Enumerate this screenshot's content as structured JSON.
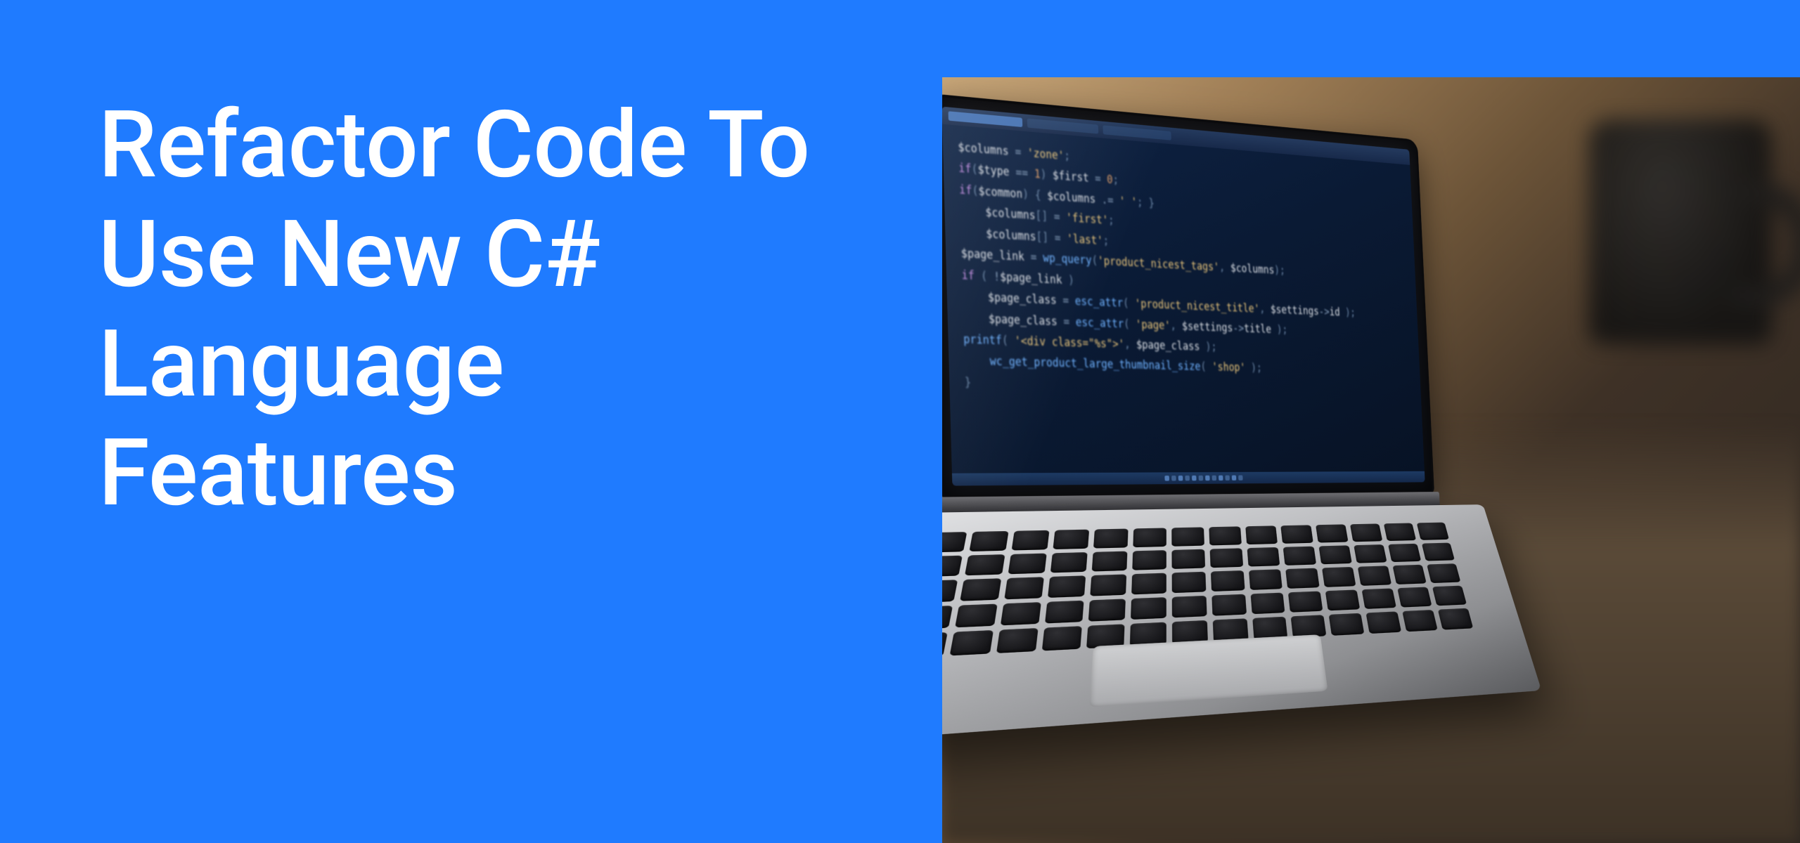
{
  "headline": "Refactor Code To Use New C# Language Features",
  "colors": {
    "background": "#1f7bff",
    "headline_text": "#ffffff"
  },
  "photo": {
    "description": "Open silver laptop on a wooden desk showing a dark code editor with syntax-highlighted source code; a black coffee mug is blurred in the background.",
    "code_lines": [
      {
        "indent": 0,
        "tokens": [
          {
            "t": "$columns",
            "c": "var"
          },
          {
            "t": " = ",
            "c": "op"
          },
          {
            "t": "'zone'",
            "c": "str"
          },
          {
            "t": ";",
            "c": "punc"
          }
        ]
      },
      {
        "indent": 0,
        "tokens": [
          {
            "t": "if",
            "c": "kw"
          },
          {
            "t": "(",
            "c": "punc"
          },
          {
            "t": "$type",
            "c": "var"
          },
          {
            "t": " == ",
            "c": "op"
          },
          {
            "t": "1",
            "c": "num"
          },
          {
            "t": ") ",
            "c": "punc"
          },
          {
            "t": "$first",
            "c": "var"
          },
          {
            "t": " = ",
            "c": "op"
          },
          {
            "t": "0",
            "c": "num"
          },
          {
            "t": ";",
            "c": "punc"
          }
        ]
      },
      {
        "indent": 0,
        "tokens": [
          {
            "t": "if",
            "c": "kw"
          },
          {
            "t": "(",
            "c": "punc"
          },
          {
            "t": "$common",
            "c": "var"
          },
          {
            "t": ") ",
            "c": "punc"
          },
          {
            "t": "{ ",
            "c": "punc"
          },
          {
            "t": "$columns",
            "c": "var"
          },
          {
            "t": " .= ",
            "c": "op"
          },
          {
            "t": "' '",
            "c": "str"
          },
          {
            "t": ";",
            "c": "punc"
          },
          {
            "t": " }",
            "c": "punc"
          }
        ]
      },
      {
        "indent": 2,
        "tokens": [
          {
            "t": "$columns",
            "c": "var"
          },
          {
            "t": "[",
            "c": "punc"
          },
          {
            "t": "]",
            "c": "punc"
          },
          {
            "t": " = ",
            "c": "op"
          },
          {
            "t": "'first'",
            "c": "str"
          },
          {
            "t": ";",
            "c": "punc"
          }
        ]
      },
      {
        "indent": 2,
        "tokens": [
          {
            "t": "$columns",
            "c": "var"
          },
          {
            "t": "[",
            "c": "punc"
          },
          {
            "t": "]",
            "c": "punc"
          },
          {
            "t": " = ",
            "c": "op"
          },
          {
            "t": "'last'",
            "c": "str"
          },
          {
            "t": ";",
            "c": "punc"
          }
        ]
      },
      {
        "indent": 0,
        "tokens": [
          {
            "t": "$page_link",
            "c": "var"
          },
          {
            "t": " = ",
            "c": "op"
          },
          {
            "t": "wp_query",
            "c": "fn"
          },
          {
            "t": "(",
            "c": "punc"
          },
          {
            "t": "'product_nicest_tags'",
            "c": "str"
          },
          {
            "t": ", ",
            "c": "punc"
          },
          {
            "t": "$columns",
            "c": "var"
          },
          {
            "t": ");",
            "c": "punc"
          }
        ]
      },
      {
        "indent": 0,
        "tokens": [
          {
            "t": "if",
            "c": "kw"
          },
          {
            "t": " ( ",
            "c": "punc"
          },
          {
            "t": "!",
            "c": "op"
          },
          {
            "t": "$page_link",
            "c": "var"
          },
          {
            "t": " )",
            "c": "punc"
          }
        ]
      },
      {
        "indent": 2,
        "tokens": [
          {
            "t": "$page_class",
            "c": "var"
          },
          {
            "t": " = ",
            "c": "op"
          },
          {
            "t": "esc_attr",
            "c": "fn"
          },
          {
            "t": "( ",
            "c": "punc"
          },
          {
            "t": "'product_nicest_title'",
            "c": "str"
          },
          {
            "t": ", ",
            "c": "punc"
          },
          {
            "t": "$settings",
            "c": "var"
          },
          {
            "t": "->",
            "c": "op"
          },
          {
            "t": "id",
            "c": "var"
          },
          {
            "t": " );",
            "c": "punc"
          }
        ]
      },
      {
        "indent": 2,
        "tokens": [
          {
            "t": "$page_class",
            "c": "var"
          },
          {
            "t": " = ",
            "c": "op"
          },
          {
            "t": "esc_attr",
            "c": "fn"
          },
          {
            "t": "( ",
            "c": "punc"
          },
          {
            "t": "'page'",
            "c": "str"
          },
          {
            "t": ", ",
            "c": "punc"
          },
          {
            "t": "$settings",
            "c": "var"
          },
          {
            "t": "->",
            "c": "op"
          },
          {
            "t": "title",
            "c": "var"
          },
          {
            "t": " );",
            "c": "punc"
          }
        ]
      },
      {
        "indent": 0,
        "tokens": [
          {
            "t": "printf",
            "c": "fn"
          },
          {
            "t": "( ",
            "c": "punc"
          },
          {
            "t": "'<div class=\"%s\">'",
            "c": "str"
          },
          {
            "t": ", ",
            "c": "punc"
          },
          {
            "t": "$page_class",
            "c": "var"
          },
          {
            "t": " );",
            "c": "punc"
          }
        ]
      },
      {
        "indent": 2,
        "tokens": [
          {
            "t": "wc_get_product_large_thumbnail_size",
            "c": "fn"
          },
          {
            "t": "( ",
            "c": "punc"
          },
          {
            "t": "'shop'",
            "c": "str"
          },
          {
            "t": " );",
            "c": "punc"
          }
        ]
      },
      {
        "indent": 0,
        "tokens": [
          {
            "t": "}",
            "c": "punc"
          }
        ]
      }
    ]
  }
}
